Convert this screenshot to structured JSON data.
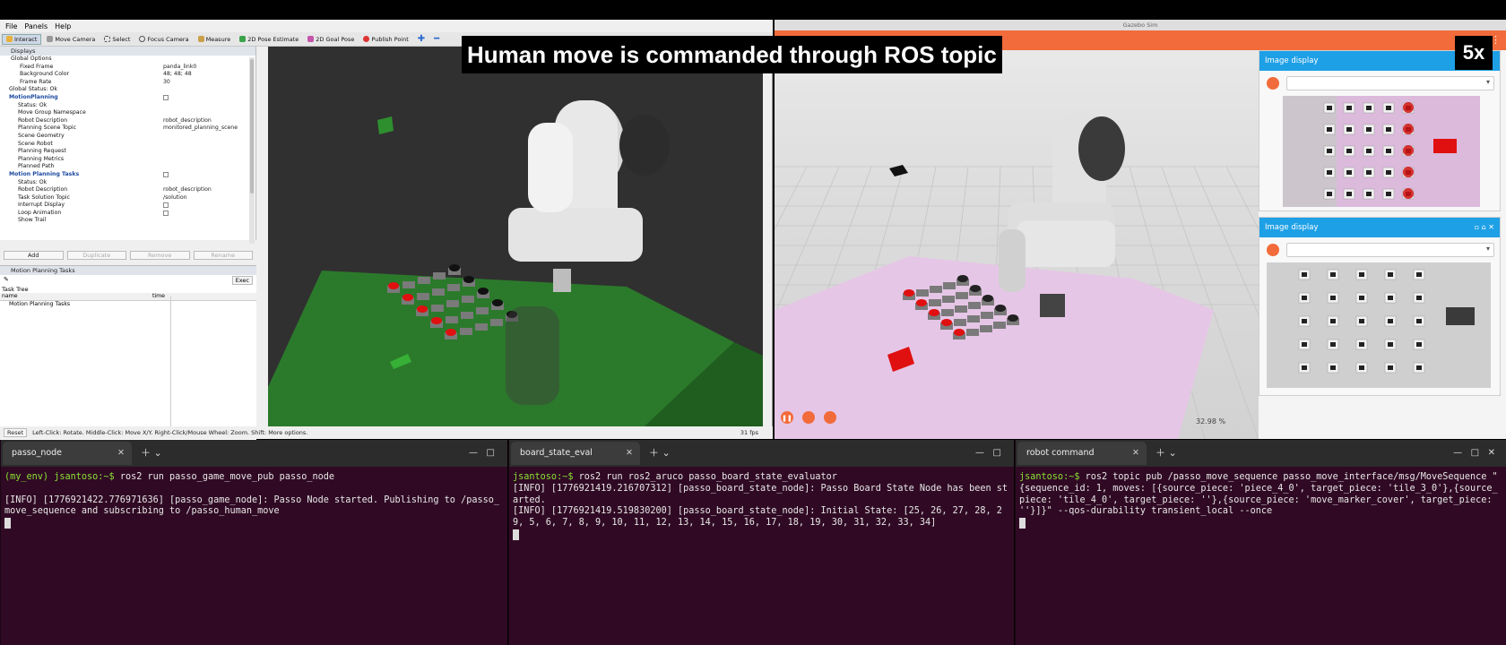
{
  "overlay": {
    "banner": "Human move is commanded through ROS topic",
    "speed": "5x"
  },
  "rviz": {
    "menu": [
      "File",
      "Panels",
      "Help"
    ],
    "toolbar": [
      "Interact",
      "Move Camera",
      "Select",
      "Focus Camera",
      "Measure",
      "2D Pose Estimate",
      "2D Goal Pose",
      "Publish Point"
    ],
    "displays_title": "Displays",
    "rows": [
      {
        "label": "Global Options",
        "value": ""
      },
      {
        "label": "Fixed Frame",
        "value": "panda_link0"
      },
      {
        "label": "Background Color",
        "value": "48; 48; 48"
      },
      {
        "label": "Frame Rate",
        "value": "30"
      },
      {
        "label": "Global Status: Ok",
        "value": ""
      },
      {
        "label": "MotionPlanning",
        "value": ""
      },
      {
        "label": "Status: Ok",
        "value": ""
      },
      {
        "label": "Move Group Namespace",
        "value": ""
      },
      {
        "label": "Robot Description",
        "value": "robot_description"
      },
      {
        "label": "Planning Scene Topic",
        "value": "monitored_planning_scene"
      },
      {
        "label": "Scene Geometry",
        "value": ""
      },
      {
        "label": "Scene Robot",
        "value": ""
      },
      {
        "label": "Planning Request",
        "value": ""
      },
      {
        "label": "Planning Metrics",
        "value": ""
      },
      {
        "label": "Planned Path",
        "value": ""
      },
      {
        "label": "Motion Planning Tasks",
        "value": ""
      },
      {
        "label": "Status: Ok",
        "value": ""
      },
      {
        "label": "Robot Description",
        "value": "robot_description"
      },
      {
        "label": "Task Solution Topic",
        "value": "/solution"
      },
      {
        "label": "Interrupt Display",
        "value": ""
      },
      {
        "label": "Loop Animation",
        "value": ""
      },
      {
        "label": "Show Trail",
        "value": ""
      }
    ],
    "buttons": [
      "Add",
      "Duplicate",
      "Remove",
      "Rename"
    ],
    "mpt_title": "Motion Planning Tasks",
    "exec": "Exec",
    "task_tree": "Task Tree",
    "col_name": "name",
    "col_time": "time",
    "task_item": "Motion Planning Tasks",
    "status_reset": "Reset",
    "status_text": "Left-Click: Rotate. Middle-Click: Move X/Y. Right-Click/Mouse Wheel: Zoom. Shift: More options.",
    "fps": "31 fps"
  },
  "gazebo": {
    "title": "Gazebo Sim",
    "image_display_1": "Image display",
    "image_display_2": "Image display",
    "zoom": "32.98 %"
  },
  "terminals": [
    {
      "tab": "passo_node",
      "lines": [
        {
          "prompt": "(my_env) jsantoso:~$ ",
          "text": "ros2 run passo_game_move_pub passo_node"
        },
        {
          "prompt": "",
          "text": ""
        },
        {
          "prompt": "",
          "text": "[INFO] [1776921422.776971636] [passo_game_node]: Passo Node started. Publishing to /passo_move_sequence and subscribing to /passo_human_move"
        }
      ]
    },
    {
      "tab": "board_state_eval",
      "lines": [
        {
          "prompt": "jsantoso:~$ ",
          "text": "ros2 run ros2_aruco passo_board_state_evaluator"
        },
        {
          "prompt": "",
          "text": "[INFO] [1776921419.216707312] [passo_board_state_node]: Passo Board State Node has been started."
        },
        {
          "prompt": "",
          "text": "[INFO] [1776921419.519830200] [passo_board_state_node]: Initial State: [25, 26, 27, 28, 29, 5, 6, 7, 8, 9, 10, 11, 12, 13, 14, 15, 16, 17, 18, 19, 30, 31, 32, 33, 34]"
        }
      ]
    },
    {
      "tab": "robot command",
      "lines": [
        {
          "prompt": "jsantoso:~$ ",
          "text": "ros2 topic pub /passo_move_sequence passo_move_interface/msg/MoveSequence \"{sequence_id: 1, moves: [{source_piece: 'piece_4_0', target_piece: 'tile_3_0'},{source_piece: 'tile_4_0', target_piece: ''},{source_piece: 'move_marker_cover', target_piece: ''}]}\" --qos-durability transient_local --once"
        }
      ]
    }
  ]
}
